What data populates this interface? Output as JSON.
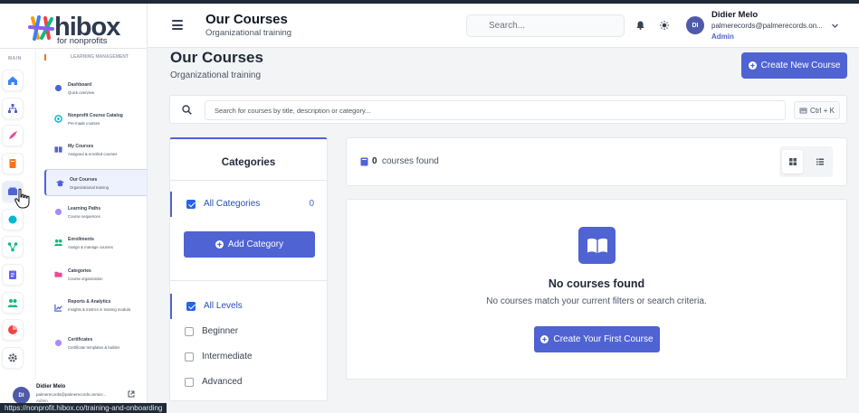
{
  "app": {
    "logo_text": "hibox",
    "logo_sub": "for nonprofits",
    "status_url": "https://nonprofit.hibox.co/training-and-onboarding"
  },
  "header": {
    "title": "Our Courses",
    "subtitle": "Organizational training",
    "search_placeholder": "Search...",
    "user": {
      "initials": "DI",
      "name": "Didier Melo",
      "email": "palmerecords@palmerecords.on...",
      "role": "Admin"
    }
  },
  "sidebar": {
    "main_label": "MAIN",
    "section_label": "LEARNING MANAGEMENT",
    "rail": [
      {
        "icon": "home-icon",
        "color": "#3b82f6"
      },
      {
        "icon": "sitemap-icon",
        "color": "#4f63d2"
      },
      {
        "icon": "rocket-icon",
        "color": "#ec4899"
      },
      {
        "icon": "book-icon",
        "color": "#f97316"
      },
      {
        "icon": "courses-icon",
        "color": "#4f63d2"
      },
      {
        "icon": "circle-icon",
        "color": "#06b6d4"
      },
      {
        "icon": "share-nodes-icon",
        "color": "#10b981"
      },
      {
        "icon": "clipboard-icon",
        "color": "#6366f1"
      },
      {
        "icon": "users-icon",
        "color": "#10b981"
      },
      {
        "icon": "chart-pie-icon",
        "color": "#ef4444"
      },
      {
        "icon": "gear-icon",
        "color": "#4b5563"
      }
    ],
    "items": [
      {
        "title": "Dashboard",
        "sub": "Quick overview",
        "icon": "dashboard-icon",
        "color": "#4f63d2"
      },
      {
        "title": "Nonprofit Course Catalog",
        "sub": "Pre-made courses",
        "icon": "catalog-icon",
        "color": "#06b6d4"
      },
      {
        "title": "My Courses",
        "sub": "Assigned & enrolled courses",
        "icon": "my-courses-icon",
        "color": "#4f63d2"
      },
      {
        "title": "Our Courses",
        "sub": "Organizational training",
        "icon": "our-courses-icon",
        "color": "#4f63d2"
      },
      {
        "title": "Learning Paths",
        "sub": "Course sequences",
        "icon": "learning-paths-icon",
        "color": "#8b5cf6"
      },
      {
        "title": "Enrollments",
        "sub": "Assign & manage courses",
        "icon": "enrollments-icon",
        "color": "#10b981"
      },
      {
        "title": "Categories",
        "sub": "Course organization",
        "icon": "categories-icon",
        "color": "#ec4899"
      },
      {
        "title": "Reports & Analytics",
        "sub": "Insights & metrics in training modula",
        "icon": "reports-icon",
        "color": "#4f63d2"
      },
      {
        "title": "Certificates",
        "sub": "Certificate templates & builder",
        "icon": "certificates-icon",
        "color": "#8b5cf6"
      }
    ],
    "user": {
      "initials": "DI",
      "name": "Didier Melo",
      "email": "palmerecords@palmerecords.onmicr...",
      "role": "Admin"
    }
  },
  "page": {
    "title": "Our Courses",
    "subtitle": "Organizational training",
    "create_button": "Create New Course",
    "search_placeholder": "Search for courses by title, description or category...",
    "shortcut": "Ctrl + K"
  },
  "categories": {
    "title": "Categories",
    "all_label": "All Categories",
    "all_count": "0",
    "add_button": "Add Category",
    "levels": [
      {
        "label": "All Levels",
        "checked": true
      },
      {
        "label": "Beginner",
        "checked": false
      },
      {
        "label": "Intermediate",
        "checked": false
      },
      {
        "label": "Advanced",
        "checked": false
      }
    ]
  },
  "results": {
    "count": "0",
    "label": "courses found"
  },
  "empty": {
    "title": "No courses found",
    "message": "No courses match your current filters or search criteria.",
    "button": "Create Your First Course"
  }
}
